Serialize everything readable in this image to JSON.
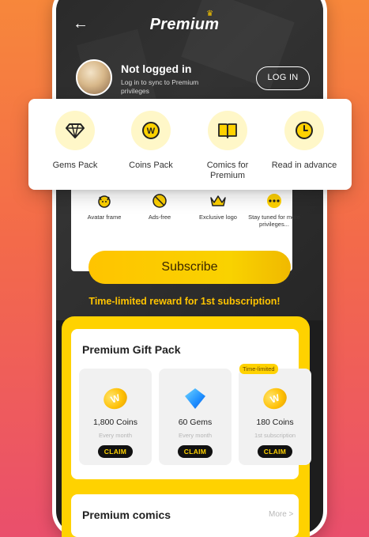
{
  "header": {
    "title": "Premium",
    "back_icon": "arrow-left-icon"
  },
  "user": {
    "name": "Not logged in",
    "subtitle": "Log in to sync to Premium privileges",
    "login_label": "LOG IN"
  },
  "top_privileges": [
    {
      "label": "Gems Pack",
      "icon": "diamond-icon"
    },
    {
      "label": "Coins Pack",
      "icon": "coin-icon"
    },
    {
      "label": "Comics for Premium",
      "icon": "book-icon"
    },
    {
      "label": "Read in advance",
      "icon": "clock-icon"
    }
  ],
  "more_privileges": [
    {
      "label": "Avatar frame",
      "icon": "avatar-frame-icon"
    },
    {
      "label": "Ads-free",
      "icon": "no-ads-icon"
    },
    {
      "label": "Exclusive logo",
      "icon": "crown-icon"
    },
    {
      "label": "Stay tuned for more privileges...",
      "icon": "more-dots-icon"
    }
  ],
  "subscribe": {
    "label": "Subscribe",
    "promo": "Time-limited reward for 1st subscription!"
  },
  "gift_pack": {
    "title": "Premium Gift Pack",
    "badge": "Time-limited",
    "items": [
      {
        "amount": "1,800 Coins",
        "period": "Every month",
        "claim": "CLAIM",
        "icon": "coin-icon"
      },
      {
        "amount": "60 Gems",
        "period": "Every month",
        "claim": "CLAIM",
        "icon": "gem-icon"
      },
      {
        "amount": "180 Coins",
        "period": "1st subscription",
        "claim": "CLAIM",
        "icon": "coin-icon"
      }
    ]
  },
  "comics": {
    "title": "Premium comics",
    "more": "More >"
  },
  "colors": {
    "accent": "#ffd200",
    "background_top": "#f7873b",
    "background_bottom": "#ea4f6c",
    "dark": "#1d1d1d"
  }
}
